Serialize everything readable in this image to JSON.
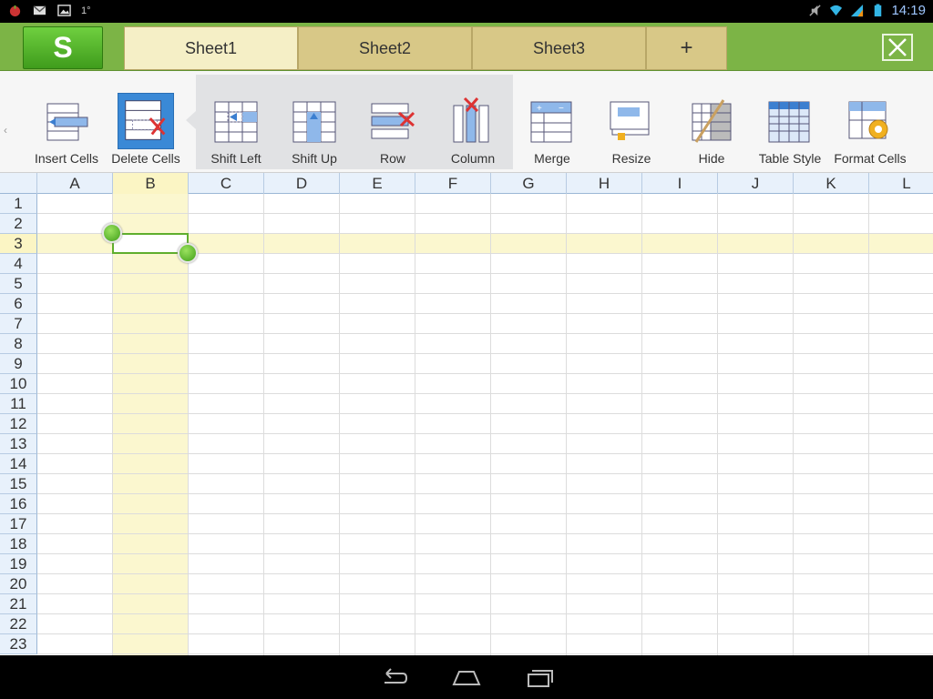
{
  "status": {
    "time": "14:19",
    "left_icons": [
      "app-notification-icon",
      "gmail-icon",
      "image-icon"
    ],
    "degree": "1°",
    "right_icons": [
      "mute-icon",
      "wifi-icon",
      "signal-icon",
      "battery-icon"
    ]
  },
  "app": {
    "logo_letter": "S",
    "tabs": [
      {
        "label": "Sheet1",
        "active": true
      },
      {
        "label": "Sheet2",
        "active": false
      },
      {
        "label": "Sheet3",
        "active": false
      }
    ],
    "add_tab_label": "+"
  },
  "toolbar": {
    "items": [
      {
        "label": "Insert Cells",
        "icon": "insert-cells-icon"
      },
      {
        "label": "Delete Cells",
        "icon": "delete-cells-icon",
        "selected": true
      },
      {
        "label": "Shift Left",
        "icon": "shift-left-icon"
      },
      {
        "label": "Shift Up",
        "icon": "shift-up-icon"
      },
      {
        "label": "Row",
        "icon": "delete-row-icon"
      },
      {
        "label": "Column",
        "icon": "delete-column-icon"
      },
      {
        "label": "Merge",
        "icon": "merge-icon"
      },
      {
        "label": "Resize",
        "icon": "resize-icon"
      },
      {
        "label": "Hide",
        "icon": "hide-icon"
      },
      {
        "label": "Table Style",
        "icon": "table-style-icon"
      },
      {
        "label": "Format Cells",
        "icon": "format-cells-icon"
      }
    ]
  },
  "sheet": {
    "columns": [
      "A",
      "B",
      "C",
      "D",
      "E",
      "F",
      "G",
      "H",
      "I",
      "J",
      "K",
      "L"
    ],
    "rows": [
      "1",
      "2",
      "3",
      "4",
      "5",
      "6",
      "7",
      "8",
      "9",
      "10",
      "11",
      "12",
      "13",
      "14",
      "15",
      "16",
      "17",
      "18",
      "19",
      "20",
      "21",
      "22",
      "23"
    ],
    "selected_cell": "B3"
  },
  "colors": {
    "app_green": "#7cb446",
    "selection_green": "#5fae2d",
    "highlight_yellow": "#fbf7cf",
    "tool_selected_blue": "#3a89d6"
  }
}
